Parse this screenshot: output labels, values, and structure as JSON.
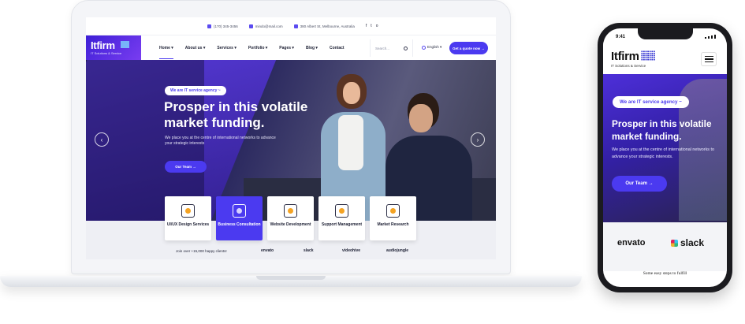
{
  "laptop": {
    "infobar": {
      "phone": "(170) 345-3456",
      "email": "mindo@mail.com",
      "address": "380 Albert St, Melbourne, Australia",
      "social": [
        "f",
        "t",
        "o"
      ]
    },
    "logo": {
      "name": "Itfirm",
      "tagline": "IT Solutions & Service"
    },
    "menu": [
      "Home ▾",
      "About us ▾",
      "Services ▾",
      "Portfolio ▾",
      "Pages ▾",
      "Blog ▾",
      "Contact"
    ],
    "search_placeholder": "Search...",
    "language": "English ▾",
    "quote_button": "Get a quote now →",
    "hero": {
      "badge": "We are IT service agency ~",
      "title": "Prosper in this volatile market funding.",
      "description": "We place you at the centre of international networks to advance your strategic interests",
      "cta": "Our Team →",
      "prev_arrow": "‹",
      "next_arrow": "›"
    },
    "services": [
      {
        "label": "UI/UX Design Services",
        "active": false
      },
      {
        "label": "Business Consultation",
        "active": true
      },
      {
        "label": "Website Development",
        "active": false
      },
      {
        "label": "Support Management",
        "active": false
      },
      {
        "label": "Market Research",
        "active": false
      }
    ],
    "clients": {
      "happy_text": "Join over +15,000 happy clients!",
      "brands": [
        "envato",
        "slack",
        "videohive",
        "audiojungle"
      ]
    }
  },
  "phone": {
    "time": "9:41",
    "logo": {
      "name": "Itfirm",
      "tagline": "IT Solutions & Service"
    },
    "hero": {
      "badge": "We are IT service agency ~",
      "title": "Prosper in this volatile market funding.",
      "description": "We place you at the centre of international networks to advance your strategic interests.",
      "cta": "Our Team →"
    },
    "brands": [
      "envato",
      "slack"
    ],
    "steps_text": "Some easy steps to fulfill"
  },
  "colors": {
    "accent": "#4b3af0",
    "accent_dark": "#3d1fd6",
    "text_dark": "#1c1f33"
  }
}
